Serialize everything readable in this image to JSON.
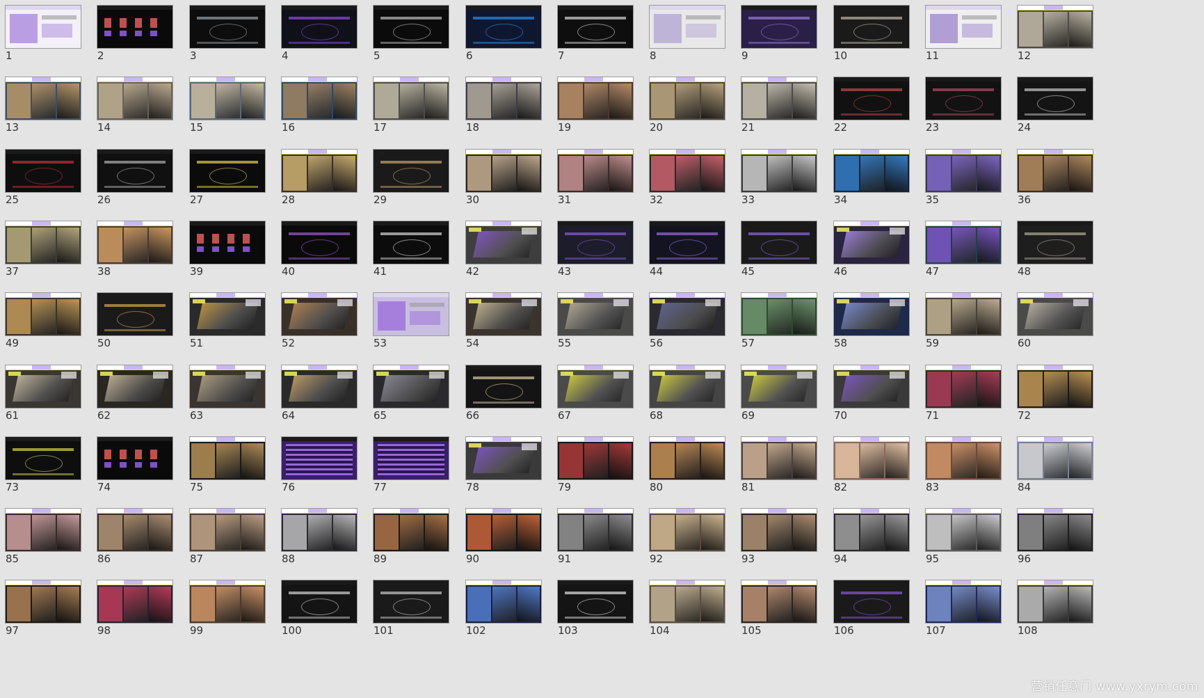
{
  "viewer": {
    "watermark": "营销任意门 www.yxrym.com"
  },
  "slides": [
    {
      "n": "1",
      "bg": "#f3f0f8",
      "accent": "#8a5bd1",
      "style": "light"
    },
    {
      "n": "2",
      "bg": "#0a0a0a",
      "accent": "#d65757",
      "style": "icons"
    },
    {
      "n": "3",
      "bg": "#0d0d0d",
      "accent": "#9aa0a6",
      "style": "dark"
    },
    {
      "n": "4",
      "bg": "#101018",
      "accent": "#8e4fe0",
      "style": "dark"
    },
    {
      "n": "5",
      "bg": "#0b0b0b",
      "accent": "#bdbdbd",
      "style": "dark"
    },
    {
      "n": "6",
      "bg": "#0f1730",
      "accent": "#2d8de0",
      "style": "dark"
    },
    {
      "n": "7",
      "bg": "#0e0e0e",
      "accent": "#d6d6d6",
      "style": "dark"
    },
    {
      "n": "8",
      "bg": "#e8e8e8",
      "accent": "#9b88c9",
      "style": "light"
    },
    {
      "n": "9",
      "bg": "#2a1f47",
      "accent": "#9c7ad8",
      "style": "dark"
    },
    {
      "n": "10",
      "bg": "#1a1a1a",
      "accent": "#bcb7a4",
      "style": "dark"
    },
    {
      "n": "11",
      "bg": "#efefef",
      "accent": "#7c5bc0",
      "style": "light"
    },
    {
      "n": "12",
      "bg": "#4f4a44",
      "accent": "#cfc8b6",
      "style": "photo"
    },
    {
      "n": "13",
      "bg": "#3f4e63",
      "accent": "#c9a36a",
      "style": "photo"
    },
    {
      "n": "14",
      "bg": "#6a6159",
      "accent": "#c8b89a",
      "style": "photo"
    },
    {
      "n": "15",
      "bg": "#5a6a7a",
      "accent": "#d9c8a8",
      "style": "photo"
    },
    {
      "n": "16",
      "bg": "#2f4a66",
      "accent": "#b08c62",
      "style": "photo"
    },
    {
      "n": "17",
      "bg": "#4d4d4d",
      "accent": "#d0c9b0",
      "style": "photo"
    },
    {
      "n": "18",
      "bg": "#3e3e45",
      "accent": "#c0b8a8",
      "style": "photo"
    },
    {
      "n": "19",
      "bg": "#4a3a30",
      "accent": "#c89a72",
      "style": "photo"
    },
    {
      "n": "20",
      "bg": "#524638",
      "accent": "#c7b28a",
      "style": "photo"
    },
    {
      "n": "21",
      "bg": "#4b4b4b",
      "accent": "#d9d2c0",
      "style": "photo"
    },
    {
      "n": "22",
      "bg": "#111111",
      "accent": "#c34a4a",
      "style": "dark"
    },
    {
      "n": "23",
      "bg": "#121212",
      "accent": "#b84c6a",
      "style": "dark"
    },
    {
      "n": "24",
      "bg": "#141414",
      "accent": "#c9c9c9",
      "style": "dark"
    },
    {
      "n": "25",
      "bg": "#0e0e0e",
      "accent": "#c72f3a",
      "style": "dark"
    },
    {
      "n": "26",
      "bg": "#101010",
      "accent": "#b0b0b0",
      "style": "dark"
    },
    {
      "n": "27",
      "bg": "#0b0b0b",
      "accent": "#e1d24a",
      "style": "dark"
    },
    {
      "n": "28",
      "bg": "#3a2e2a",
      "accent": "#e0c27a",
      "style": "photo"
    },
    {
      "n": "29",
      "bg": "#1a1a1a",
      "accent": "#c4a472",
      "style": "dark"
    },
    {
      "n": "30",
      "bg": "#2a2420",
      "accent": "#d8c0a0",
      "style": "photo"
    },
    {
      "n": "31",
      "bg": "#3a2a2a",
      "accent": "#d9a0a0",
      "style": "photo"
    },
    {
      "n": "32",
      "bg": "#2a2a2a",
      "accent": "#e06a78",
      "style": "photo"
    },
    {
      "n": "33",
      "bg": "#3a3a3a",
      "accent": "#e0e0e0",
      "style": "photo"
    },
    {
      "n": "34",
      "bg": "#13233a",
      "accent": "#3a8ad8",
      "style": "photo"
    },
    {
      "n": "35",
      "bg": "#3a3a55",
      "accent": "#8a6fd6",
      "style": "photo"
    },
    {
      "n": "36",
      "bg": "#3a2a22",
      "accent": "#c49a6a",
      "style": "photo"
    },
    {
      "n": "37",
      "bg": "#3c3c36",
      "accent": "#c8b88a",
      "style": "photo"
    },
    {
      "n": "38",
      "bg": "#4a3a32",
      "accent": "#e0a86a",
      "style": "photo"
    },
    {
      "n": "39",
      "bg": "#0a0a0a",
      "accent": "#d65757",
      "style": "icons"
    },
    {
      "n": "40",
      "bg": "#0a0a0a",
      "accent": "#9c5ad6",
      "style": "dark"
    },
    {
      "n": "41",
      "bg": "#0c0c0c",
      "accent": "#d6d6d6",
      "style": "dark"
    },
    {
      "n": "42",
      "bg": "#3e3e3e",
      "accent": "#8e5ad8",
      "style": "render"
    },
    {
      "n": "43",
      "bg": "#1c1c2a",
      "accent": "#8a5ad8",
      "style": "dark"
    },
    {
      "n": "44",
      "bg": "#141420",
      "accent": "#9a6ae0",
      "style": "dark"
    },
    {
      "n": "45",
      "bg": "#1a1a1a",
      "accent": "#8a6ae0",
      "style": "dark"
    },
    {
      "n": "46",
      "bg": "#2a2440",
      "accent": "#b090f0",
      "style": "render"
    },
    {
      "n": "47",
      "bg": "#23404a",
      "accent": "#8a5ad8",
      "style": "photo"
    },
    {
      "n": "48",
      "bg": "#1e1e1e",
      "accent": "#b0a890",
      "style": "dark"
    },
    {
      "n": "49",
      "bg": "#3a3328",
      "accent": "#d4a860",
      "style": "photo"
    },
    {
      "n": "50",
      "bg": "#1a1a1a",
      "accent": "#d8a84a",
      "style": "dark"
    },
    {
      "n": "51",
      "bg": "#2a2a2a",
      "accent": "#d8a84a",
      "style": "render"
    },
    {
      "n": "52",
      "bg": "#3a302a",
      "accent": "#c4905a",
      "style": "render"
    },
    {
      "n": "53",
      "bg": "#c8bfe0",
      "accent": "#8a4ad8",
      "style": "light"
    },
    {
      "n": "54",
      "bg": "#3a342c",
      "accent": "#d8c8a0",
      "style": "render"
    },
    {
      "n": "55",
      "bg": "#4a4a48",
      "accent": "#c0b8a0",
      "style": "render"
    },
    {
      "n": "56",
      "bg": "#2a2a30",
      "accent": "#6a70a0",
      "style": "render"
    },
    {
      "n": "57",
      "bg": "#2f4a2f",
      "accent": "#7aa07a",
      "style": "photo"
    },
    {
      "n": "58",
      "bg": "#1e2a4a",
      "accent": "#8a9ae0",
      "style": "render"
    },
    {
      "n": "59",
      "bg": "#4a4236",
      "accent": "#d0c0a0",
      "style": "photo"
    },
    {
      "n": "60",
      "bg": "#4a4a48",
      "accent": "#c8c0b0",
      "style": "render"
    },
    {
      "n": "61",
      "bg": "#3a3632",
      "accent": "#d8ccb0",
      "style": "render"
    },
    {
      "n": "62",
      "bg": "#2a2622",
      "accent": "#d8c8a8",
      "style": "render"
    },
    {
      "n": "63",
      "bg": "#3a3530",
      "accent": "#c0b090",
      "style": "render"
    },
    {
      "n": "64",
      "bg": "#2a2a2a",
      "accent": "#d8b070",
      "style": "render"
    },
    {
      "n": "65",
      "bg": "#2a2a2e",
      "accent": "#9a9aa8",
      "style": "render"
    },
    {
      "n": "66",
      "bg": "#141414",
      "accent": "#d8c8a0",
      "style": "dark"
    },
    {
      "n": "67",
      "bg": "#4a4a4a",
      "accent": "#e0e040",
      "style": "render"
    },
    {
      "n": "68",
      "bg": "#454545",
      "accent": "#e0e040",
      "style": "render"
    },
    {
      "n": "69",
      "bg": "#4a4a4a",
      "accent": "#e0e040",
      "style": "render"
    },
    {
      "n": "70",
      "bg": "#3a3a3a",
      "accent": "#8a5ad8",
      "style": "render"
    },
    {
      "n": "71",
      "bg": "#2a2a2a",
      "accent": "#c04060",
      "style": "photo"
    },
    {
      "n": "72",
      "bg": "#1e1a16",
      "accent": "#d8a860",
      "style": "photo"
    },
    {
      "n": "73",
      "bg": "#0e0e0e",
      "accent": "#d6d64a",
      "style": "dark"
    },
    {
      "n": "74",
      "bg": "#0a0a0a",
      "accent": "#d65757",
      "style": "icons"
    },
    {
      "n": "75",
      "bg": "#1a1a1a",
      "accent": "#c8a060",
      "style": "photo"
    },
    {
      "n": "76",
      "bg": "#3a1f6a",
      "accent": "#a070e0",
      "style": "purple"
    },
    {
      "n": "77",
      "bg": "#3a1f6a",
      "accent": "#a070e0",
      "style": "purple"
    },
    {
      "n": "78",
      "bg": "#3a3a3a",
      "accent": "#8a5ad8",
      "style": "render"
    },
    {
      "n": "79",
      "bg": "#1a1418",
      "accent": "#c04040",
      "style": "photo"
    },
    {
      "n": "80",
      "bg": "#2a1e18",
      "accent": "#d8a060",
      "style": "photo"
    },
    {
      "n": "81",
      "bg": "#4a4040",
      "accent": "#e0c0a0",
      "style": "photo"
    },
    {
      "n": "82",
      "bg": "#8a6a5a",
      "accent": "#f0d0b0",
      "style": "photo"
    },
    {
      "n": "83",
      "bg": "#6a4a3a",
      "accent": "#e0a070",
      "style": "photo"
    },
    {
      "n": "84",
      "bg": "#7a8090",
      "accent": "#e0e0e0",
      "style": "photo"
    },
    {
      "n": "85",
      "bg": "#3a2a2a",
      "accent": "#e0b0b0",
      "style": "photo"
    },
    {
      "n": "86",
      "bg": "#3a3028",
      "accent": "#c0a080",
      "style": "photo"
    },
    {
      "n": "87",
      "bg": "#4a4038",
      "accent": "#d0b090",
      "style": "photo"
    },
    {
      "n": "88",
      "bg": "#2a2a30",
      "accent": "#d0d0d0",
      "style": "photo"
    },
    {
      "n": "89",
      "bg": "#1e1814",
      "accent": "#c08050",
      "style": "photo"
    },
    {
      "n": "90",
      "bg": "#141414",
      "accent": "#e07040",
      "style": "photo"
    },
    {
      "n": "91",
      "bg": "#2a2a2a",
      "accent": "#a0a0a0",
      "style": "photo"
    },
    {
      "n": "92",
      "bg": "#5a4a3a",
      "accent": "#e0c8a0",
      "style": "photo"
    },
    {
      "n": "93",
      "bg": "#2a2420",
      "accent": "#c0a080",
      "style": "photo"
    },
    {
      "n": "94",
      "bg": "#2a2a2a",
      "accent": "#b0b0b0",
      "style": "photo"
    },
    {
      "n": "95",
      "bg": "#5a5a5a",
      "accent": "#e0e0e0",
      "style": "photo"
    },
    {
      "n": "96",
      "bg": "#1e1e1e",
      "accent": "#a0a0a0",
      "style": "photo"
    },
    {
      "n": "97",
      "bg": "#1e1814",
      "accent": "#c09060",
      "style": "photo"
    },
    {
      "n": "98",
      "bg": "#2a2030",
      "accent": "#d04060",
      "style": "photo"
    },
    {
      "n": "99",
      "bg": "#4a3a2a",
      "accent": "#e0a070",
      "style": "photo"
    },
    {
      "n": "100",
      "bg": "#141414",
      "accent": "#d0d0d0",
      "style": "dark"
    },
    {
      "n": "101",
      "bg": "#1a1a1a",
      "accent": "#c8c8c8",
      "style": "dark"
    },
    {
      "n": "102",
      "bg": "#1a2040",
      "accent": "#5a8ae0",
      "style": "photo"
    },
    {
      "n": "103",
      "bg": "#141414",
      "accent": "#e0e0e0",
      "style": "dark"
    },
    {
      "n": "104",
      "bg": "#5a4e40",
      "accent": "#d0c0a0",
      "style": "photo"
    },
    {
      "n": "105",
      "bg": "#2a2420",
      "accent": "#d0a080",
      "style": "photo"
    },
    {
      "n": "106",
      "bg": "#1a1a1a",
      "accent": "#8a5ad8",
      "style": "dark"
    },
    {
      "n": "107",
      "bg": "#1e2a5a",
      "accent": "#8aa0e0",
      "style": "photo"
    },
    {
      "n": "108",
      "bg": "#3a3a3a",
      "accent": "#d0d0d0",
      "style": "photo"
    }
  ]
}
